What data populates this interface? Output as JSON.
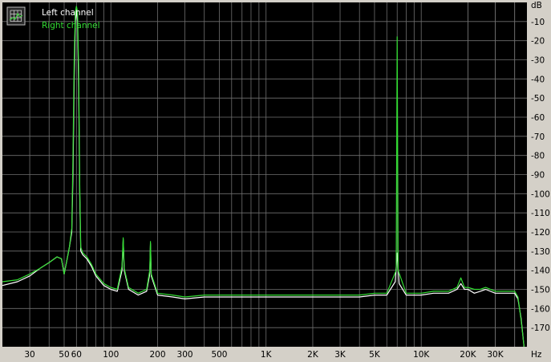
{
  "chart_data": {
    "type": "line",
    "title": "",
    "xlabel": "Hz",
    "ylabel": "dB",
    "x_scale": "log",
    "xlim": [
      20,
      48000
    ],
    "ylim": [
      -180,
      0
    ],
    "grid": true,
    "legend_position": "top-left",
    "x_tick_labels": [
      "30",
      "50",
      "60",
      "100",
      "200",
      "300",
      "500",
      "1K",
      "2K",
      "3K",
      "5K",
      "10K",
      "20K",
      "30K"
    ],
    "x_tick_values": [
      30,
      50,
      60,
      100,
      200,
      300,
      500,
      1000,
      2000,
      3000,
      5000,
      10000,
      20000,
      30000
    ],
    "y_tick_labels": [
      "-10",
      "-20",
      "-30",
      "-40",
      "-50",
      "-60",
      "-70",
      "-80",
      "-90",
      "-100",
      "-110",
      "-120",
      "-130",
      "-140",
      "-150",
      "-160",
      "-170"
    ],
    "y_tick_values": [
      -10,
      -20,
      -30,
      -40,
      -50,
      -60,
      -70,
      -80,
      -90,
      -100,
      -110,
      -120,
      -130,
      -140,
      -150,
      -160,
      -170
    ],
    "series": [
      {
        "name": "Left channel",
        "color": "#ffffff",
        "x": [
          20,
          25,
          30,
          35,
          40,
          45,
          48,
          50,
          52,
          54,
          56,
          57,
          58,
          59,
          60,
          61,
          62,
          63,
          64,
          66,
          70,
          75,
          80,
          90,
          100,
          110,
          118,
          120,
          122,
          130,
          150,
          170,
          178,
          180,
          182,
          200,
          250,
          300,
          400,
          500,
          700,
          1000,
          1500,
          2000,
          3000,
          4000,
          5000,
          6000,
          6800,
          7000,
          7200,
          8000,
          10000,
          12000,
          15000,
          17000,
          18000,
          19000,
          20000,
          22000,
          24000,
          26000,
          30000,
          35000,
          40000,
          42000,
          44000,
          46000
        ],
        "y": [
          -148,
          -146,
          -143,
          -139,
          -136,
          -133,
          -134,
          -142,
          -135,
          -128,
          -120,
          -90,
          -40,
          -10,
          -4,
          -10,
          -45,
          -100,
          -130,
          -132,
          -134,
          -138,
          -143,
          -148,
          -150,
          -151,
          -140,
          -124,
          -140,
          -150,
          -153,
          -151,
          -142,
          -126,
          -143,
          -153,
          -154,
          -155,
          -154,
          -154,
          -154,
          -154,
          -154,
          -154,
          -154,
          -154,
          -153,
          -153,
          -146,
          -131,
          -147,
          -153,
          -153,
          -152,
          -152,
          -150,
          -147,
          -150,
          -150,
          -152,
          -151,
          -150,
          -152,
          -152,
          -152,
          -155,
          -165,
          -180
        ]
      },
      {
        "name": "Right channel",
        "color": "#33dd33",
        "x": [
          20,
          25,
          30,
          35,
          40,
          45,
          48,
          50,
          52,
          54,
          56,
          57,
          58,
          59,
          60,
          61,
          62,
          63,
          64,
          66,
          70,
          75,
          80,
          90,
          100,
          110,
          118,
          120,
          122,
          130,
          150,
          170,
          178,
          180,
          182,
          200,
          250,
          300,
          400,
          500,
          700,
          1000,
          1500,
          2000,
          3000,
          4000,
          5000,
          6000,
          6900,
          7000,
          7100,
          8000,
          10000,
          12000,
          15000,
          17000,
          18000,
          19000,
          20000,
          22000,
          24000,
          26000,
          30000,
          35000,
          40000,
          42000,
          44000,
          46000
        ],
        "y": [
          -146,
          -145,
          -142,
          -139,
          -136,
          -133,
          -134,
          -142,
          -135,
          -128,
          -118,
          -80,
          -30,
          -5,
          -2,
          -5,
          -35,
          -95,
          -128,
          -131,
          -133,
          -137,
          -142,
          -147,
          -149,
          -150,
          -138,
          -123,
          -139,
          -149,
          -152,
          -150,
          -140,
          -125,
          -142,
          -152,
          -153,
          -154,
          -153,
          -153,
          -153,
          -153,
          -153,
          -153,
          -153,
          -153,
          -152,
          -152,
          -140,
          -18,
          -140,
          -152,
          -152,
          -151,
          -151,
          -149,
          -144,
          -149,
          -149,
          -150,
          -150,
          -149,
          -151,
          -151,
          -151,
          -154,
          -166,
          -180
        ]
      }
    ]
  }
}
